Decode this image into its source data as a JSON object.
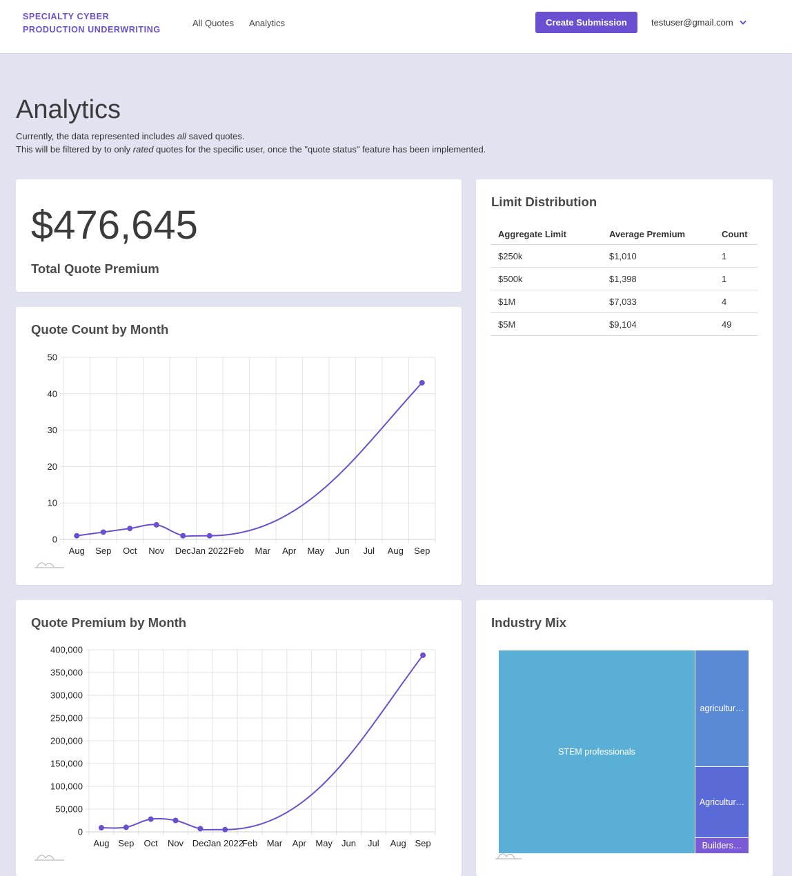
{
  "header": {
    "brand_line1": "SPECIALTY CYBER",
    "brand_line2": "PRODUCTION UNDERWRITING",
    "nav": [
      "All Quotes",
      "Analytics"
    ],
    "create_button": "Create Submission",
    "user_email": "testuser@gmail.com",
    "accent_color": "#6a4fd0"
  },
  "page": {
    "title": "Analytics",
    "desc1_pre": "Currently, the data represented includes ",
    "desc1_em": "all",
    "desc1_post": " saved quotes.",
    "desc2_pre": "This will be filtered by to only ",
    "desc2_em": "rated",
    "desc2_post": " quotes for the specific user, once the \"quote status\" feature has been implemented."
  },
  "total_premium": {
    "value": "$476,645",
    "label": "Total Quote Premium"
  },
  "limit_distribution": {
    "title": "Limit Distribution",
    "columns": [
      "Aggregate Limit",
      "Average Premium",
      "Count"
    ],
    "rows": [
      [
        "$250k",
        "$1,010",
        "1"
      ],
      [
        "$500k",
        "$1,398",
        "1"
      ],
      [
        "$1M",
        "$7,033",
        "4"
      ],
      [
        "$5M",
        "$9,104",
        "49"
      ]
    ]
  },
  "quote_count_title": "Quote Count by Month",
  "quote_premium_title": "Quote Premium by Month",
  "industry_mix_title": "Industry Mix",
  "chart_data": [
    {
      "type": "line",
      "title": "Quote Count by Month",
      "x": [
        "Aug",
        "Sep",
        "Oct",
        "Nov",
        "Dec",
        "Jan 2022",
        "Feb",
        "Mar",
        "Apr",
        "May",
        "Jun",
        "Jul",
        "Aug",
        "Sep"
      ],
      "points": [
        {
          "x": "Aug",
          "y": 1
        },
        {
          "x": "Sep",
          "y": 2
        },
        {
          "x": "Oct",
          "y": 3
        },
        {
          "x": "Nov",
          "y": 4
        },
        {
          "x": "Dec",
          "y": 1
        },
        {
          "x": "Jan 2022",
          "y": 1
        },
        {
          "x": "Sep",
          "y": 43
        }
      ],
      "yticks": [
        "0",
        "10",
        "20",
        "30",
        "40",
        "50"
      ],
      "ylim": [
        0,
        50
      ],
      "grid": true,
      "color": "#6a4fd0"
    },
    {
      "type": "line",
      "title": "Quote Premium by Month",
      "x": [
        "Aug",
        "Sep",
        "Oct",
        "Nov",
        "Dec",
        "Jan 2022",
        "Feb",
        "Mar",
        "Apr",
        "May",
        "Jun",
        "Jul",
        "Aug",
        "Sep"
      ],
      "points": [
        {
          "x": "Aug",
          "y": 9000
        },
        {
          "x": "Sep",
          "y": 10000
        },
        {
          "x": "Oct",
          "y": 28000
        },
        {
          "x": "Nov",
          "y": 25000
        },
        {
          "x": "Dec",
          "y": 7000
        },
        {
          "x": "Jan 2022",
          "y": 5000
        },
        {
          "x": "Sep",
          "y": 388000
        }
      ],
      "yticks": [
        "0",
        "50,000",
        "100,000",
        "150,000",
        "200,000",
        "250,000",
        "300,000",
        "350,000",
        "400,000"
      ],
      "ylim": [
        0,
        400000
      ],
      "grid": true,
      "color": "#6a4fd0"
    },
    {
      "type": "treemap",
      "title": "Industry Mix",
      "nodes": [
        {
          "label": "STEM professionals",
          "share": 0.785,
          "color": "#5aafd6"
        },
        {
          "label": "agricultur…",
          "share": 0.123,
          "color": "#5a8ad6"
        },
        {
          "label": "Agricultur…",
          "share": 0.075,
          "color": "#5a6ad6"
        },
        {
          "label": "Builders…",
          "share": 0.017,
          "color": "#7a5ad6"
        }
      ]
    }
  ]
}
